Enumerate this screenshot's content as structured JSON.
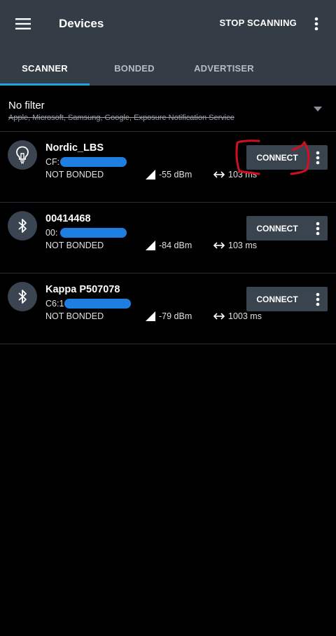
{
  "appbar": {
    "title": "Devices",
    "stop_label": "STOP SCANNING"
  },
  "tabs": [
    {
      "label": "SCANNER",
      "active": true
    },
    {
      "label": "BONDED",
      "active": false
    },
    {
      "label": "ADVERTISER",
      "active": false
    }
  ],
  "filter": {
    "title": "No filter",
    "subtitle": "Apple, Microsoft, Samsung, Google, Exposure Notification Service"
  },
  "devices": [
    {
      "name": "Nordic_LBS",
      "address": "CF:",
      "bond": "NOT BONDED",
      "rssi": "-55 dBm",
      "interval": "103 ms",
      "icon": "lightbulb-icon",
      "connect": "CONNECT"
    },
    {
      "name": "00414468",
      "address": "00:",
      "bond": "NOT BONDED",
      "rssi": "-84 dBm",
      "interval": "103 ms",
      "icon": "bluetooth-icon",
      "connect": "CONNECT"
    },
    {
      "name": "Kappa P507078",
      "address": "C6:1",
      "bond": "NOT BONDED",
      "rssi": "-79 dBm",
      "interval": "1003 ms",
      "icon": "bluetooth-icon",
      "connect": "CONNECT"
    }
  ],
  "colors": {
    "appbar": "#343c45",
    "accent": "#1ea6dc",
    "button": "#3a444f",
    "annotation": "#d01020"
  }
}
